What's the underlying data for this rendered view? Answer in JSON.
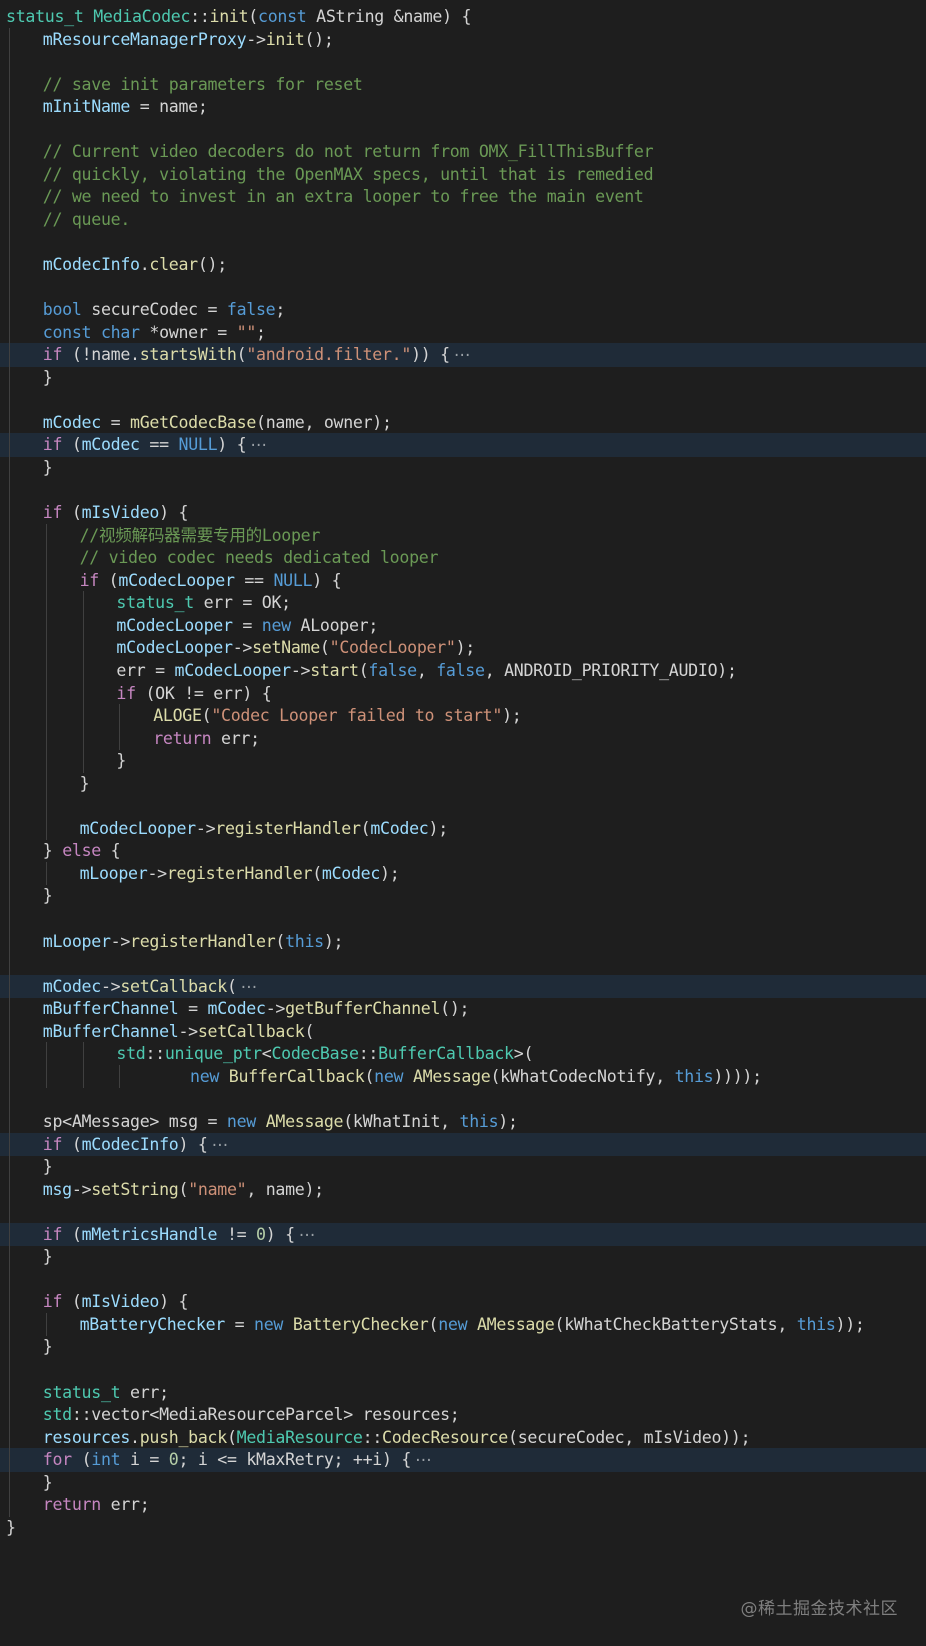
{
  "editor": {
    "theme": {
      "background": "#1e1e1e",
      "highlight": "#1f2b38"
    },
    "lines": [
      {
        "indent": 0,
        "tokens": [
          [
            "t",
            "status_t"
          ],
          [
            "p",
            " "
          ],
          [
            "t",
            "MediaCodec"
          ],
          [
            "p",
            "::"
          ],
          [
            "f",
            "init"
          ],
          [
            "p",
            "("
          ],
          [
            "k",
            "const"
          ],
          [
            "p",
            " AString &name) {"
          ]
        ]
      },
      {
        "indent": 1,
        "tokens": [
          [
            "v",
            "mResourceManagerProxy"
          ],
          [
            "p",
            "->"
          ],
          [
            "f",
            "init"
          ],
          [
            "p",
            "();"
          ]
        ]
      },
      {
        "indent": 1,
        "tokens": []
      },
      {
        "indent": 1,
        "tokens": [
          [
            "m",
            "// save init parameters for reset"
          ]
        ]
      },
      {
        "indent": 1,
        "tokens": [
          [
            "v",
            "mInitName"
          ],
          [
            "p",
            " = name;"
          ]
        ]
      },
      {
        "indent": 1,
        "tokens": []
      },
      {
        "indent": 1,
        "tokens": [
          [
            "m",
            "// Current video decoders do not return from OMX_FillThisBuffer"
          ]
        ]
      },
      {
        "indent": 1,
        "tokens": [
          [
            "m",
            "// quickly, violating the OpenMAX specs, until that is remedied"
          ]
        ]
      },
      {
        "indent": 1,
        "tokens": [
          [
            "m",
            "// we need to invest in an extra looper to free the main event"
          ]
        ]
      },
      {
        "indent": 1,
        "tokens": [
          [
            "m",
            "// queue."
          ]
        ]
      },
      {
        "indent": 1,
        "tokens": []
      },
      {
        "indent": 1,
        "tokens": [
          [
            "v",
            "mCodecInfo"
          ],
          [
            "p",
            "."
          ],
          [
            "f",
            "clear"
          ],
          [
            "p",
            "();"
          ]
        ]
      },
      {
        "indent": 1,
        "tokens": []
      },
      {
        "indent": 1,
        "tokens": [
          [
            "k",
            "bool"
          ],
          [
            "p",
            " secureCodec = "
          ],
          [
            "k",
            "false"
          ],
          [
            "p",
            ";"
          ]
        ]
      },
      {
        "indent": 1,
        "tokens": [
          [
            "k",
            "const"
          ],
          [
            "p",
            " "
          ],
          [
            "k",
            "char"
          ],
          [
            "p",
            " *owner = "
          ],
          [
            "s",
            "\"\""
          ],
          [
            "p",
            ";"
          ]
        ]
      },
      {
        "indent": 1,
        "hl": true,
        "tokens": [
          [
            "c",
            "if"
          ],
          [
            "p",
            " (!name."
          ],
          [
            "f",
            "startsWith"
          ],
          [
            "p",
            "("
          ],
          [
            "s",
            "\"android.filter.\""
          ],
          [
            "p",
            ")) {"
          ]
        ],
        "folded": "⋯"
      },
      {
        "indent": 1,
        "tokens": [
          [
            "p",
            "}"
          ]
        ]
      },
      {
        "indent": 1,
        "tokens": []
      },
      {
        "indent": 1,
        "tokens": [
          [
            "v",
            "mCodec"
          ],
          [
            "p",
            " = "
          ],
          [
            "f",
            "mGetCodecBase"
          ],
          [
            "p",
            "(name, owner);"
          ]
        ]
      },
      {
        "indent": 1,
        "hl": true,
        "tokens": [
          [
            "c",
            "if"
          ],
          [
            "p",
            " ("
          ],
          [
            "v",
            "mCodec"
          ],
          [
            "p",
            " == "
          ],
          [
            "k",
            "NULL"
          ],
          [
            "p",
            ") {"
          ]
        ],
        "folded": "⋯"
      },
      {
        "indent": 1,
        "tokens": [
          [
            "p",
            "}"
          ]
        ]
      },
      {
        "indent": 1,
        "tokens": []
      },
      {
        "indent": 1,
        "tokens": [
          [
            "c",
            "if"
          ],
          [
            "p",
            " ("
          ],
          [
            "v",
            "mIsVideo"
          ],
          [
            "p",
            ") {"
          ]
        ]
      },
      {
        "indent": 2,
        "tokens": [
          [
            "m",
            "//视频解码器需要专用的Looper"
          ]
        ]
      },
      {
        "indent": 2,
        "tokens": [
          [
            "m",
            "// video codec needs dedicated looper"
          ]
        ]
      },
      {
        "indent": 2,
        "tokens": [
          [
            "c",
            "if"
          ],
          [
            "p",
            " ("
          ],
          [
            "v",
            "mCodecLooper"
          ],
          [
            "p",
            " == "
          ],
          [
            "k",
            "NULL"
          ],
          [
            "p",
            ") {"
          ]
        ]
      },
      {
        "indent": 3,
        "tokens": [
          [
            "t",
            "status_t"
          ],
          [
            "p",
            " err = OK;"
          ]
        ]
      },
      {
        "indent": 3,
        "tokens": [
          [
            "v",
            "mCodecLooper"
          ],
          [
            "p",
            " = "
          ],
          [
            "k",
            "new"
          ],
          [
            "p",
            " ALooper;"
          ]
        ]
      },
      {
        "indent": 3,
        "tokens": [
          [
            "v",
            "mCodecLooper"
          ],
          [
            "p",
            "->"
          ],
          [
            "f",
            "setName"
          ],
          [
            "p",
            "("
          ],
          [
            "s",
            "\"CodecLooper\""
          ],
          [
            "p",
            ");"
          ]
        ]
      },
      {
        "indent": 3,
        "tokens": [
          [
            "p",
            "err = "
          ],
          [
            "v",
            "mCodecLooper"
          ],
          [
            "p",
            "->"
          ],
          [
            "f",
            "start"
          ],
          [
            "p",
            "("
          ],
          [
            "k",
            "false"
          ],
          [
            "p",
            ", "
          ],
          [
            "k",
            "false"
          ],
          [
            "p",
            ", ANDROID_PRIORITY_AUDIO);"
          ]
        ]
      },
      {
        "indent": 3,
        "tokens": [
          [
            "c",
            "if"
          ],
          [
            "p",
            " (OK != err) {"
          ]
        ]
      },
      {
        "indent": 4,
        "tokens": [
          [
            "f",
            "ALOGE"
          ],
          [
            "p",
            "("
          ],
          [
            "s",
            "\"Codec Looper failed to start\""
          ],
          [
            "p",
            ");"
          ]
        ]
      },
      {
        "indent": 4,
        "tokens": [
          [
            "c",
            "return"
          ],
          [
            "p",
            " err;"
          ]
        ]
      },
      {
        "indent": 3,
        "tokens": [
          [
            "p",
            "}"
          ]
        ]
      },
      {
        "indent": 2,
        "tokens": [
          [
            "p",
            "}"
          ]
        ]
      },
      {
        "indent": 2,
        "tokens": []
      },
      {
        "indent": 2,
        "tokens": [
          [
            "v",
            "mCodecLooper"
          ],
          [
            "p",
            "->"
          ],
          [
            "f",
            "registerHandler"
          ],
          [
            "p",
            "("
          ],
          [
            "v",
            "mCodec"
          ],
          [
            "p",
            ");"
          ]
        ]
      },
      {
        "indent": 1,
        "tokens": [
          [
            "p",
            "} "
          ],
          [
            "c",
            "else"
          ],
          [
            "p",
            " {"
          ]
        ]
      },
      {
        "indent": 2,
        "tokens": [
          [
            "v",
            "mLooper"
          ],
          [
            "p",
            "->"
          ],
          [
            "f",
            "registerHandler"
          ],
          [
            "p",
            "("
          ],
          [
            "v",
            "mCodec"
          ],
          [
            "p",
            ");"
          ]
        ]
      },
      {
        "indent": 1,
        "tokens": [
          [
            "p",
            "}"
          ]
        ]
      },
      {
        "indent": 1,
        "tokens": []
      },
      {
        "indent": 1,
        "tokens": [
          [
            "v",
            "mLooper"
          ],
          [
            "p",
            "->"
          ],
          [
            "f",
            "registerHandler"
          ],
          [
            "p",
            "("
          ],
          [
            "k",
            "this"
          ],
          [
            "p",
            ");"
          ]
        ]
      },
      {
        "indent": 1,
        "tokens": []
      },
      {
        "indent": 1,
        "hl": true,
        "tokens": [
          [
            "v",
            "mCodec"
          ],
          [
            "p",
            "->"
          ],
          [
            "f",
            "setCallback"
          ],
          [
            "p",
            "("
          ]
        ],
        "folded": "⋯"
      },
      {
        "indent": 1,
        "tokens": [
          [
            "v",
            "mBufferChannel"
          ],
          [
            "p",
            " = "
          ],
          [
            "v",
            "mCodec"
          ],
          [
            "p",
            "->"
          ],
          [
            "f",
            "getBufferChannel"
          ],
          [
            "p",
            "();"
          ]
        ]
      },
      {
        "indent": 1,
        "tokens": [
          [
            "v",
            "mBufferChannel"
          ],
          [
            "p",
            "->"
          ],
          [
            "f",
            "setCallback"
          ],
          [
            "p",
            "("
          ]
        ]
      },
      {
        "indent": 3,
        "guides": [
          1,
          2
        ],
        "tokens": [
          [
            "t",
            "std"
          ],
          [
            "p",
            "::"
          ],
          [
            "t",
            "unique_ptr"
          ],
          [
            "p",
            "<"
          ],
          [
            "t",
            "CodecBase"
          ],
          [
            "p",
            "::"
          ],
          [
            "t",
            "BufferCallback"
          ],
          [
            "p",
            ">("
          ]
        ]
      },
      {
        "indent": 5,
        "guides": [
          1,
          2,
          3
        ],
        "tokens": [
          [
            "k",
            "new"
          ],
          [
            "p",
            " "
          ],
          [
            "f",
            "BufferCallback"
          ],
          [
            "p",
            "("
          ],
          [
            "k",
            "new"
          ],
          [
            "p",
            " "
          ],
          [
            "f",
            "AMessage"
          ],
          [
            "p",
            "(kWhatCodecNotify, "
          ],
          [
            "k",
            "this"
          ],
          [
            "p",
            "))));"
          ]
        ]
      },
      {
        "indent": 1,
        "tokens": []
      },
      {
        "indent": 1,
        "tokens": [
          [
            "p",
            "sp<AMessage> msg = "
          ],
          [
            "k",
            "new"
          ],
          [
            "p",
            " "
          ],
          [
            "f",
            "AMessage"
          ],
          [
            "p",
            "(kWhatInit, "
          ],
          [
            "k",
            "this"
          ],
          [
            "p",
            ");"
          ]
        ]
      },
      {
        "indent": 1,
        "hl": true,
        "tokens": [
          [
            "c",
            "if"
          ],
          [
            "p",
            " ("
          ],
          [
            "v",
            "mCodecInfo"
          ],
          [
            "p",
            ") {"
          ]
        ],
        "folded": "⋯"
      },
      {
        "indent": 1,
        "tokens": [
          [
            "p",
            "}"
          ]
        ]
      },
      {
        "indent": 1,
        "tokens": [
          [
            "v",
            "msg"
          ],
          [
            "p",
            "->"
          ],
          [
            "f",
            "setString"
          ],
          [
            "p",
            "("
          ],
          [
            "s",
            "\"name\""
          ],
          [
            "p",
            ", name);"
          ]
        ]
      },
      {
        "indent": 1,
        "tokens": []
      },
      {
        "indent": 1,
        "hl": true,
        "tokens": [
          [
            "c",
            "if"
          ],
          [
            "p",
            " ("
          ],
          [
            "v",
            "mMetricsHandle"
          ],
          [
            "p",
            " != "
          ],
          [
            "n",
            "0"
          ],
          [
            "p",
            ") {"
          ]
        ],
        "folded": "⋯"
      },
      {
        "indent": 1,
        "tokens": [
          [
            "p",
            "}"
          ]
        ]
      },
      {
        "indent": 1,
        "tokens": []
      },
      {
        "indent": 1,
        "tokens": [
          [
            "c",
            "if"
          ],
          [
            "p",
            " ("
          ],
          [
            "v",
            "mIsVideo"
          ],
          [
            "p",
            ") {"
          ]
        ]
      },
      {
        "indent": 2,
        "tokens": [
          [
            "v",
            "mBatteryChecker"
          ],
          [
            "p",
            " = "
          ],
          [
            "k",
            "new"
          ],
          [
            "p",
            " "
          ],
          [
            "f",
            "BatteryChecker"
          ],
          [
            "p",
            "("
          ],
          [
            "k",
            "new"
          ],
          [
            "p",
            " "
          ],
          [
            "f",
            "AMessage"
          ],
          [
            "p",
            "(kWhatCheckBatteryStats, "
          ],
          [
            "k",
            "this"
          ],
          [
            "p",
            "));"
          ]
        ]
      },
      {
        "indent": 1,
        "tokens": [
          [
            "p",
            "}"
          ]
        ]
      },
      {
        "indent": 1,
        "tokens": []
      },
      {
        "indent": 1,
        "tokens": [
          [
            "t",
            "status_t"
          ],
          [
            "p",
            " err;"
          ]
        ]
      },
      {
        "indent": 1,
        "tokens": [
          [
            "t",
            "std"
          ],
          [
            "p",
            "::vector<MediaResourceParcel> resources;"
          ]
        ]
      },
      {
        "indent": 1,
        "tokens": [
          [
            "v",
            "resources"
          ],
          [
            "p",
            "."
          ],
          [
            "f",
            "push_back"
          ],
          [
            "p",
            "("
          ],
          [
            "t",
            "MediaResource"
          ],
          [
            "p",
            "::"
          ],
          [
            "f",
            "CodecResource"
          ],
          [
            "p",
            "(secureCodec, mIsVideo));"
          ]
        ]
      },
      {
        "indent": 1,
        "hl": true,
        "tokens": [
          [
            "c",
            "for"
          ],
          [
            "p",
            " ("
          ],
          [
            "k",
            "int"
          ],
          [
            "p",
            " i = "
          ],
          [
            "n",
            "0"
          ],
          [
            "p",
            "; i <= kMaxRetry; ++i) {"
          ]
        ],
        "folded": "⋯"
      },
      {
        "indent": 1,
        "tokens": [
          [
            "p",
            "}"
          ]
        ]
      },
      {
        "indent": 1,
        "tokens": [
          [
            "c",
            "return"
          ],
          [
            "p",
            " err;"
          ]
        ]
      },
      {
        "indent": 0,
        "tokens": [
          [
            "p",
            "}"
          ]
        ]
      }
    ]
  },
  "watermark": "@稀土掘金技术社区"
}
